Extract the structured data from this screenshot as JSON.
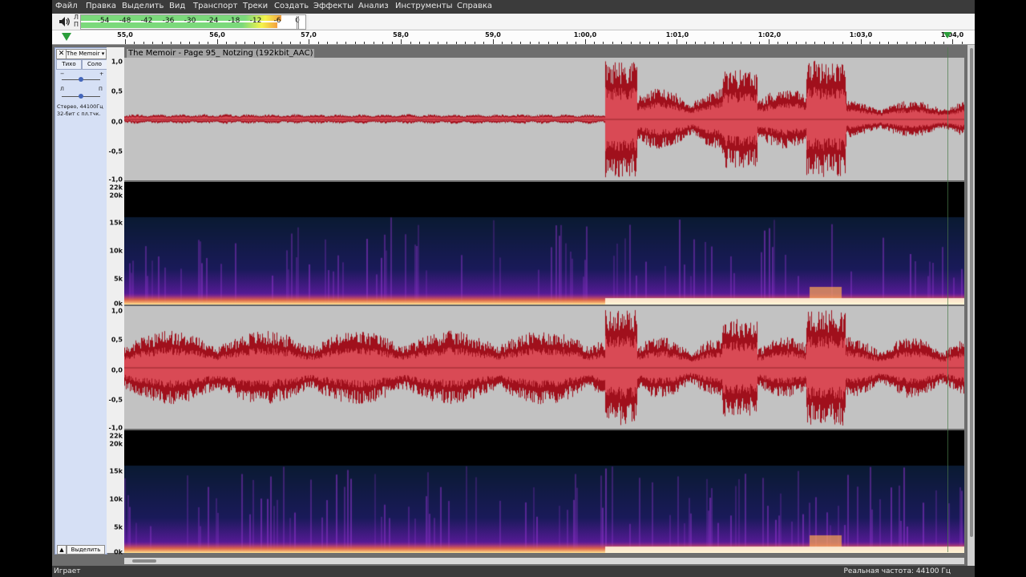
{
  "menu": [
    "Файл",
    "Правка",
    "Выделить",
    "Вид",
    "Транспорт",
    "Треки",
    "Создать",
    "Эффекты",
    "Анализ",
    "Инструменты",
    "Справка"
  ],
  "meter": {
    "channel_left": "Л",
    "channel_right": "П",
    "ticks": [
      "-54",
      "-48",
      "-42",
      "-36",
      "-30",
      "-24",
      "-18",
      "-12",
      "-6",
      "0"
    ]
  },
  "timeline": {
    "labels": [
      "55,0",
      "56,0",
      "57,0",
      "58,0",
      "59,0",
      "1:00,0",
      "1:01,0",
      "1:02,0",
      "1:03,0",
      "1:04,0"
    ]
  },
  "track": {
    "title": "The Memoir - Page 95_ Notzing (192kbit_AAC)",
    "name_short": "The Memoir",
    "mute_label": "Тихо",
    "solo_label": "Соло",
    "gain_minus": "−",
    "gain_plus": "+",
    "pan_left": "Л",
    "pan_right": "П",
    "info_line1": "Стерео, 44100Гц",
    "info_line2": "32-бит с пл.тчк.",
    "select_label": "Выделить"
  },
  "ruler": {
    "wave_top": [
      "1,0",
      "0,5",
      "0,0",
      "-0,5",
      "-1,0"
    ],
    "spec_top": [
      "22k",
      "20k",
      "15k",
      "10k",
      "5k",
      "0k"
    ],
    "wave_bottom": [
      "1,0",
      "0,5",
      "0,0",
      "-0,5",
      "-1,0"
    ],
    "spec_bottom": [
      "22k",
      "20k",
      "15k",
      "10k",
      "5k",
      "0k"
    ]
  },
  "status": {
    "left": "Играет",
    "right": "Реальная частота: 44100 Гц"
  },
  "colors": {
    "wave_bg": "#c2c2c2",
    "wave_fill": "#d94a55",
    "wave_dark": "#a0101c",
    "spec_bg": "#0c1a2a"
  }
}
